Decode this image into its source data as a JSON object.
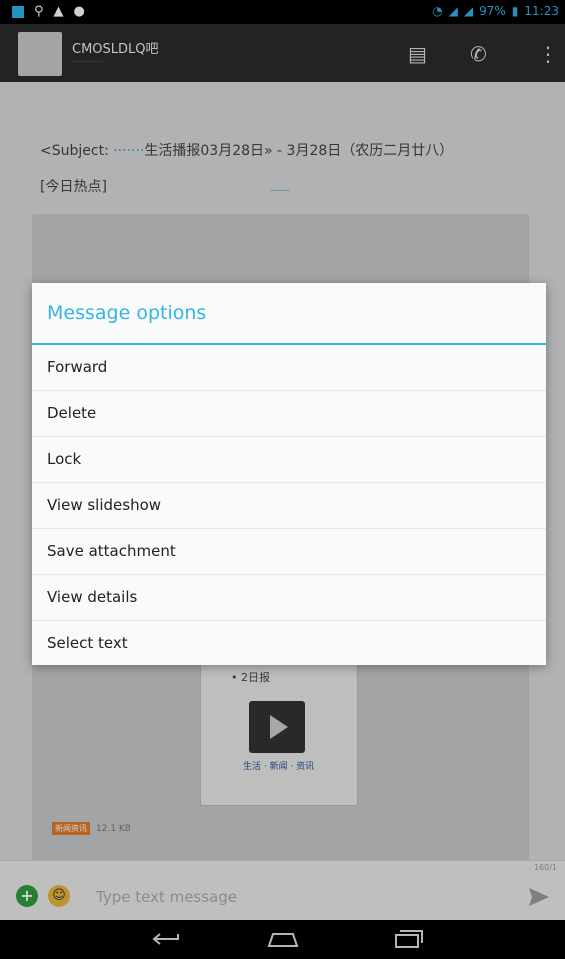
{
  "status_bar": {
    "battery": "97%",
    "time": "11:23"
  },
  "header": {
    "contact_name": "CMOSLDLQ吧",
    "icons": [
      "contact-card-icon",
      "phone-icon",
      "overflow-menu-icon"
    ]
  },
  "conversation": {
    "date_chip": "——",
    "subject_prefix": "<Subject: ",
    "subject_highlight": "·······",
    "subject_rest": "生活播报03月28日» - 3月28日（农历二月廿八）",
    "hot_topics": "[今日热点]",
    "thumbnail_label": "• 2日报",
    "thumbnail_caption": "生活 · 新闻 · 资讯",
    "tag": "新闻资讯",
    "tag_suffix": "12.1 KB"
  },
  "composer": {
    "placeholder": "Type text message",
    "counter": "160/1",
    "icons": [
      "add-attachment-icon",
      "emoji-icon",
      "send-icon"
    ]
  },
  "dialog": {
    "title": "Message options",
    "options": [
      "Forward",
      "Delete",
      "Lock",
      "View slideshow",
      "Save attachment",
      "View details",
      "Select text"
    ]
  },
  "navigation": {
    "icons": [
      "back-icon",
      "home-icon",
      "recents-icon"
    ]
  },
  "colors": {
    "accent": "#33b5e5",
    "dialog_bg": "#fafafa",
    "app_bar": "#2b2b2b"
  }
}
